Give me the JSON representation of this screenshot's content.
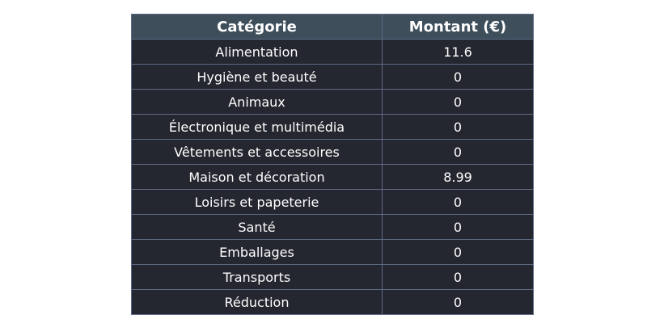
{
  "chart_data": {
    "type": "table",
    "columns": [
      "Catégorie",
      "Montant (€)"
    ],
    "rows": [
      [
        "Alimentation",
        "11.6"
      ],
      [
        "Hygiène et beauté",
        "0"
      ],
      [
        "Animaux",
        "0"
      ],
      [
        "Électronique et multimédia",
        "0"
      ],
      [
        "Vêtements et accessoires",
        "0"
      ],
      [
        "Maison et décoration",
        "8.99"
      ],
      [
        "Loisirs et papeterie",
        "0"
      ],
      [
        "Santé",
        "0"
      ],
      [
        "Emballages",
        "0"
      ],
      [
        "Transports",
        "0"
      ],
      [
        "Réduction",
        "0"
      ]
    ]
  },
  "colors": {
    "header_bg": "#3e4e5b",
    "cell_bg": "#252730",
    "border": "#5f6b86",
    "text": "#ffffff"
  }
}
